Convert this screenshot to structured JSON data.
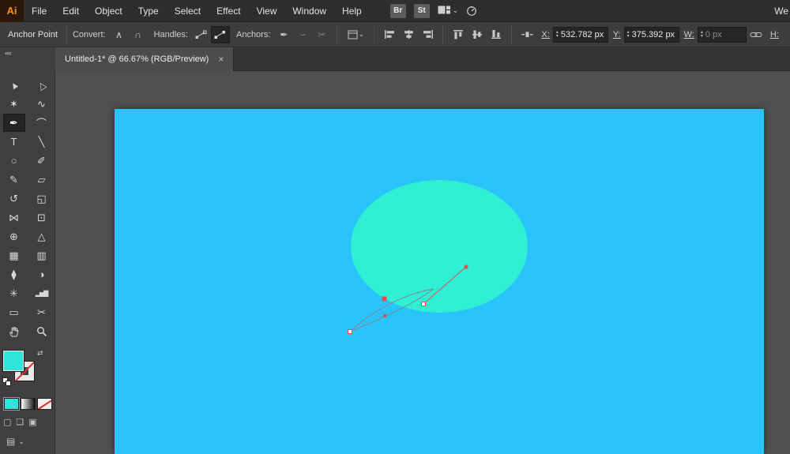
{
  "colors": {
    "artboard_blue": "#29C4F9",
    "ellipse_teal": "#2FEFD4",
    "fill_swatch": "#30E4DC",
    "anchor_red": "#E0524F",
    "path_gray": "#7D8A96"
  },
  "menubar": {
    "logo": "Ai",
    "items": [
      "File",
      "Edit",
      "Object",
      "Type",
      "Select",
      "Effect",
      "View",
      "Window",
      "Help"
    ],
    "bridge_label": "Br",
    "stock_label": "St",
    "workspace_partial": "We"
  },
  "controlbar": {
    "mode_label": "Anchor Point",
    "convert_label": "Convert:",
    "handles_label": "Handles:",
    "anchors_label": "Anchors:",
    "x_label": "X:",
    "x_value": "532.782 px",
    "y_label": "Y:",
    "y_value": "375.392 px",
    "w_label": "W:",
    "w_value": "0 px",
    "h_label": "H:"
  },
  "tabbar": {
    "title": "Untitled-1* @ 66.67% (RGB/Preview)"
  },
  "icons": {
    "close": "×",
    "chevron_down": "⌄",
    "collapse_left": "««",
    "spin_up": "▴",
    "spin_down": "▾",
    "swap_fill_stroke": "⇄",
    "convert_corner": "∧",
    "convert_smooth": "∩",
    "anchor_remove": "✒",
    "anchor_connect": "⌣",
    "anchor_cut": "✂",
    "draw_normal": "▢",
    "draw_behind": "❏",
    "draw_inside": "▣",
    "screen_mode": "▤"
  },
  "tools": {
    "items": [
      {
        "name": "selection-tool",
        "glyph": "▲",
        "cls": "rot"
      },
      {
        "name": "direct-selection-tool",
        "glyph": "△",
        "cls": "rot"
      },
      {
        "name": "magic-wand-tool",
        "glyph": "✶"
      },
      {
        "name": "lasso-tool",
        "glyph": "∿"
      },
      {
        "name": "pen-tool",
        "glyph": "✒",
        "active": true
      },
      {
        "name": "curvature-tool",
        "glyph": "⌒"
      },
      {
        "name": "type-tool",
        "glyph": "T"
      },
      {
        "name": "line-segment-tool",
        "glyph": "╲"
      },
      {
        "name": "ellipse-tool",
        "glyph": "○"
      },
      {
        "name": "paintbrush-tool",
        "glyph": "✐"
      },
      {
        "name": "pencil-tool",
        "glyph": "✎"
      },
      {
        "name": "eraser-tool",
        "glyph": "▱"
      },
      {
        "name": "rotate-tool",
        "glyph": "↺"
      },
      {
        "name": "scale-tool",
        "glyph": "◱"
      },
      {
        "name": "width-tool",
        "glyph": "⋈"
      },
      {
        "name": "free-transform-tool",
        "glyph": "⊡"
      },
      {
        "name": "shape-builder-tool",
        "glyph": "⊕"
      },
      {
        "name": "perspective-grid-tool",
        "glyph": "△"
      },
      {
        "name": "mesh-tool",
        "glyph": "▦"
      },
      {
        "name": "gradient-tool",
        "glyph": "▥"
      },
      {
        "name": "eyedropper-tool",
        "glyph": "⧫"
      },
      {
        "name": "blend-tool",
        "glyph": "◑"
      },
      {
        "name": "symbol-sprayer-tool",
        "glyph": "✳"
      },
      {
        "name": "column-graph-tool",
        "glyph": "▂▅▇",
        "cls": "tight"
      },
      {
        "name": "artboard-tool",
        "glyph": "▭"
      },
      {
        "name": "slice-tool",
        "glyph": "✂"
      },
      {
        "name": "hand-tool",
        "glyph": "svg:hand"
      },
      {
        "name": "zoom-tool",
        "glyph": "svg:zoom"
      }
    ]
  }
}
